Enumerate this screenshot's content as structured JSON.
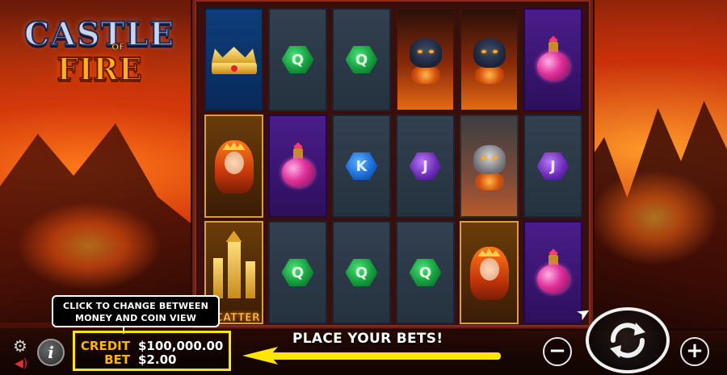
{
  "game": {
    "logo_line1": "CASTLE",
    "logo_of": "OF",
    "logo_line2": "FIRE"
  },
  "reels": {
    "columns": [
      [
        {
          "symbol": "crown-icon",
          "style": "blue"
        },
        {
          "symbol": "fire-queen-icon",
          "style": "gold"
        },
        {
          "symbol": "castle-scatter-icon",
          "style": "gold",
          "label": "SCATTER"
        }
      ],
      [
        {
          "symbol": "gem-q-icon",
          "style": "slate",
          "letter": "Q",
          "gem": "green"
        },
        {
          "symbol": "potion-icon",
          "style": "purple"
        },
        {
          "symbol": "gem-q-icon",
          "style": "slate",
          "letter": "Q",
          "gem": "green"
        }
      ],
      [
        {
          "symbol": "gem-q-icon",
          "style": "slate",
          "letter": "Q",
          "gem": "green"
        },
        {
          "symbol": "gem-k-icon",
          "style": "slate",
          "letter": "K",
          "gem": "blue"
        },
        {
          "symbol": "gem-q-icon",
          "style": "slate",
          "letter": "Q",
          "gem": "green"
        }
      ],
      [
        {
          "symbol": "panther-icon",
          "style": "fire"
        },
        {
          "symbol": "gem-j-icon",
          "style": "slate",
          "letter": "J",
          "gem": "purple"
        },
        {
          "symbol": "gem-q-icon",
          "style": "slate",
          "letter": "Q",
          "gem": "green"
        }
      ],
      [
        {
          "symbol": "panther-icon",
          "style": "fire"
        },
        {
          "symbol": "wolf-icon",
          "style": "mist"
        },
        {
          "symbol": "fire-queen-icon",
          "style": "gold"
        }
      ],
      [
        {
          "symbol": "potion-icon",
          "style": "purple"
        },
        {
          "symbol": "gem-j-icon",
          "style": "slate",
          "letter": "J",
          "gem": "purple"
        },
        {
          "symbol": "potion-icon",
          "style": "purple"
        }
      ]
    ]
  },
  "tooltip": {
    "line1": "CLICK TO CHANGE BETWEEN",
    "line2": "MONEY AND COIN VIEW"
  },
  "balance": {
    "credit_label": "CREDIT",
    "credit_value": "$100,000.00",
    "bet_label": "BET",
    "bet_value": "$2.00"
  },
  "message": "PLACE YOUR BETS!",
  "controls": {
    "minus_label": "−",
    "plus_label": "+",
    "info_label": "i"
  },
  "colors": {
    "highlight": "#ffe600",
    "label_orange": "#ffb400"
  }
}
